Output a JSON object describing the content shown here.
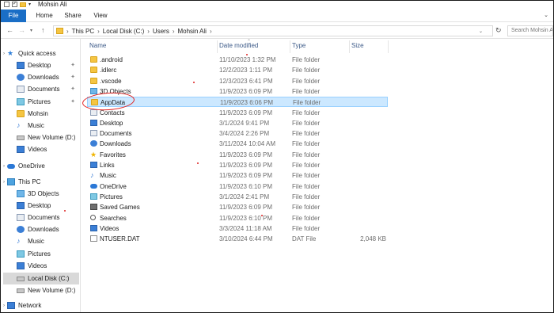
{
  "window": {
    "title": "Mohsin Ali"
  },
  "ribbon": {
    "tabs": [
      "File",
      "Home",
      "Share",
      "View"
    ]
  },
  "address": {
    "crumbs": [
      "This PC",
      "Local Disk (C:)",
      "Users",
      "Mohsin Ali"
    ],
    "search_placeholder": "Search Mohsin Ali"
  },
  "nav_pane": {
    "items": [
      {
        "label": "Quick access",
        "icon": "star-icon"
      },
      {
        "label": "Desktop",
        "icon": "desktop-icon",
        "pinned": true
      },
      {
        "label": "Downloads",
        "icon": "download-icon",
        "pinned": true
      },
      {
        "label": "Documents",
        "icon": "document-icon",
        "pinned": true
      },
      {
        "label": "Pictures",
        "icon": "picture-icon",
        "pinned": true
      },
      {
        "label": "Mohsin",
        "icon": "folder-icon"
      },
      {
        "label": "Music",
        "icon": "music-icon"
      },
      {
        "label": "New Volume (D:)",
        "icon": "drive-icon"
      },
      {
        "label": "Videos",
        "icon": "video-icon"
      },
      {
        "label": "OneDrive",
        "icon": "cloud-icon"
      },
      {
        "label": "This PC",
        "icon": "pc-icon"
      },
      {
        "label": "3D Objects",
        "icon": "cube-icon"
      },
      {
        "label": "Desktop",
        "icon": "desktop-icon"
      },
      {
        "label": "Documents",
        "icon": "document-icon"
      },
      {
        "label": "Downloads",
        "icon": "download-icon"
      },
      {
        "label": "Music",
        "icon": "music-icon"
      },
      {
        "label": "Pictures",
        "icon": "picture-icon"
      },
      {
        "label": "Videos",
        "icon": "video-icon"
      },
      {
        "label": "Local Disk (C:)",
        "icon": "drive-icon",
        "selected": true
      },
      {
        "label": "New Volume (D:)",
        "icon": "drive-icon"
      },
      {
        "label": "Network",
        "icon": "network-icon"
      }
    ]
  },
  "columns": {
    "name": "Name",
    "date": "Date modified",
    "type": "Type",
    "size": "Size"
  },
  "files": [
    {
      "name": ".android",
      "date": "11/10/2023 1:32 PM",
      "type": "File folder",
      "size": "",
      "icon": "folder"
    },
    {
      "name": ".idlerc",
      "date": "12/2/2023 1:11 PM",
      "type": "File folder",
      "size": "",
      "icon": "folder"
    },
    {
      "name": ".vscode",
      "date": "12/3/2023 6:41 PM",
      "type": "File folder",
      "size": "",
      "icon": "folder"
    },
    {
      "name": "3D Objects",
      "date": "11/9/2023 6:09 PM",
      "type": "File folder",
      "size": "",
      "icon": "cube"
    },
    {
      "name": "AppData",
      "date": "11/9/2023 6:06 PM",
      "type": "File folder",
      "size": "",
      "icon": "folder",
      "selected": true
    },
    {
      "name": "Contacts",
      "date": "11/9/2023 6:09 PM",
      "type": "File folder",
      "size": "",
      "icon": "doc"
    },
    {
      "name": "Desktop",
      "date": "3/1/2024 9:41 PM",
      "type": "File folder",
      "size": "",
      "icon": "desktop"
    },
    {
      "name": "Documents",
      "date": "3/4/2024 2:26 PM",
      "type": "File folder",
      "size": "",
      "icon": "doc"
    },
    {
      "name": "Downloads",
      "date": "3/11/2024 10:04 AM",
      "type": "File folder",
      "size": "",
      "icon": "down"
    },
    {
      "name": "Favorites",
      "date": "11/9/2023 6:09 PM",
      "type": "File folder",
      "size": "",
      "icon": "star"
    },
    {
      "name": "Links",
      "date": "11/9/2023 6:09 PM",
      "type": "File folder",
      "size": "",
      "icon": "link"
    },
    {
      "name": "Music",
      "date": "11/9/2023 6:09 PM",
      "type": "File folder",
      "size": "",
      "icon": "music"
    },
    {
      "name": "OneDrive",
      "date": "11/9/2023 6:10 PM",
      "type": "File folder",
      "size": "",
      "icon": "cloud"
    },
    {
      "name": "Pictures",
      "date": "3/1/2024 2:41 PM",
      "type": "File folder",
      "size": "",
      "icon": "pic"
    },
    {
      "name": "Saved Games",
      "date": "11/9/2023 6:09 PM",
      "type": "File folder",
      "size": "",
      "icon": "game"
    },
    {
      "name": "Searches",
      "date": "11/9/2023 6:10 PM",
      "type": "File folder",
      "size": "",
      "icon": "search"
    },
    {
      "name": "Videos",
      "date": "3/3/2024 11:18 AM",
      "type": "File folder",
      "size": "",
      "icon": "video"
    },
    {
      "name": "NTUSER.DAT",
      "date": "3/10/2024 6:44 PM",
      "type": "DAT File",
      "size": "2,048 KB",
      "icon": "file"
    }
  ]
}
